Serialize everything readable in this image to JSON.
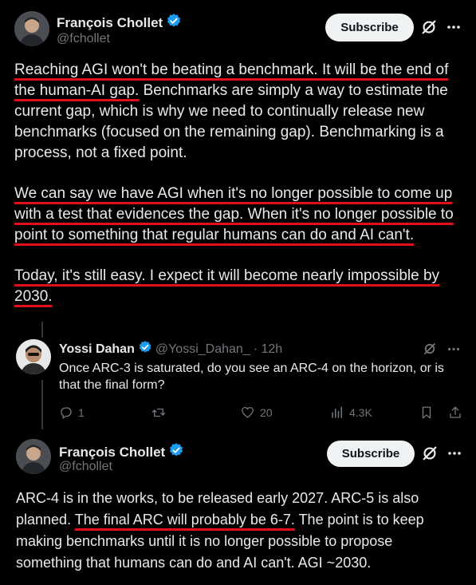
{
  "main_post": {
    "author": {
      "name": "François Chollet",
      "handle": "@fchollet"
    },
    "subscribe_label": "Subscribe",
    "paragraphs": [
      {
        "underlined": "Reaching AGI won't be beating a benchmark. It will be the end of the human-AI gap.",
        "rest": " Benchmarks are simply a way to estimate the current gap, which is why we need to continually release new benchmarks (focused on the remaining gap). Benchmarking is a process, not a fixed point."
      },
      {
        "underlined": "We can say we have AGI when it's no longer possible to come up with a test that evidences the gap. When it's no longer possible to point to something that regular humans can do and AI can't.",
        "rest": ""
      },
      {
        "underlined": "Today, it's still easy. I expect it will become nearly impossible by 2030.",
        "rest": ""
      }
    ]
  },
  "reply": {
    "author": {
      "name": "Yossi Dahan",
      "handle": "@Yossi_Dahan_",
      "time": "· 12h"
    },
    "text": "Once ARC-3 is saturated, do you see an ARC-4 on the horizon, or is that the final form?",
    "stats": {
      "replies": "1",
      "likes": "20",
      "views": "4.3K"
    }
  },
  "response": {
    "author": {
      "name": "François Chollet",
      "handle": "@fchollet"
    },
    "subscribe_label": "Subscribe",
    "before": "ARC-4 is in the works, to be released early 2027. ARC-5 is also planned. ",
    "underlined": "The final ARC will probably be 6-7.",
    "after": " The point is to keep making benchmarks until it is no longer possible to propose something that humans can do and AI can't. AGI ~2030."
  },
  "colors": {
    "accent_underline": "#e0101a",
    "verified": "#1d9bf0",
    "muted": "#71767b"
  },
  "icons": [
    "verified-badge-icon",
    "grok-icon",
    "more-icon",
    "reply-icon",
    "retweet-icon",
    "like-icon",
    "views-icon",
    "bookmark-icon",
    "share-icon"
  ]
}
